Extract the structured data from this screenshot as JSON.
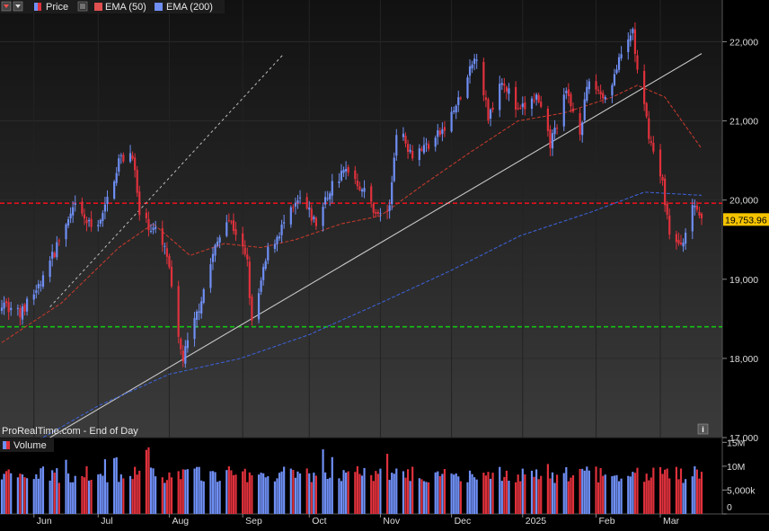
{
  "toolbar": {
    "price_label": "Price",
    "ema50_label": "EMA (50)",
    "ema200_label": "EMA (200)",
    "volume_label": "Volume"
  },
  "footer": {
    "source_text": "ProRealTime.com - End of Day",
    "info_glyph": "i"
  },
  "colors": {
    "up": "#6f8ff5",
    "down": "#e0313c",
    "ema50": "#c0392b",
    "ema200": "#3b5fd0",
    "resistance": "#e3121a",
    "support": "#13c213",
    "trendline": "#c8c8c8",
    "last_price_bg": "#f5c400"
  },
  "chart_data": {
    "type": "candlestick",
    "last_price_label": "19,753.96",
    "price_axis": {
      "ylim": [
        17000,
        22300
      ],
      "ticks": [
        "22,000",
        "21,000",
        "20,000",
        "19,000",
        "18,000",
        "17,000"
      ],
      "tick_values": [
        22000,
        21000,
        20000,
        19000,
        18000,
        17000
      ]
    },
    "volume_axis": {
      "ylim": [
        0,
        16000000
      ],
      "ticks": [
        "15M",
        "10M",
        "5,000k",
        "0"
      ],
      "tick_values": [
        15000000,
        10000000,
        5000000,
        0
      ]
    },
    "x_labels": [
      "Jun",
      "Jul",
      "Aug",
      "Sep",
      "Oct",
      "Nov",
      "Dec",
      "2025",
      "Feb",
      "Mar"
    ],
    "x_label_dates": [
      "2024-06-03",
      "2024-07-01",
      "2024-08-01",
      "2024-09-02",
      "2024-10-01",
      "2024-11-01",
      "2024-12-02",
      "2025-01-02",
      "2025-02-03",
      "2025-03-03"
    ],
    "horizontal_levels": {
      "resistance": 19960,
      "support": 18400
    },
    "trendline": {
      "from": [
        "2024-06-10",
        17000
      ],
      "to": [
        "2025-03-21",
        21850
      ]
    },
    "channel_line": {
      "from": [
        "2024-06-10",
        18650
      ],
      "to": [
        "2024-09-20",
        21850
      ]
    },
    "anchors": [
      [
        "2024-05-20",
        18720
      ],
      [
        "2024-05-28",
        18550
      ],
      [
        "2024-06-07",
        19000
      ],
      [
        "2024-06-14",
        19500
      ],
      [
        "2024-06-21",
        19900
      ],
      [
        "2024-06-28",
        19650
      ],
      [
        "2024-07-03",
        19800
      ],
      [
        "2024-07-10",
        20500
      ],
      [
        "2024-07-16",
        20600
      ],
      [
        "2024-07-19",
        19800
      ],
      [
        "2024-07-26",
        19600
      ],
      [
        "2024-07-31",
        19300
      ],
      [
        "2024-08-05",
        18200
      ],
      [
        "2024-08-07",
        18000
      ],
      [
        "2024-08-12",
        18450
      ],
      [
        "2024-08-20",
        19300
      ],
      [
        "2024-08-26",
        19800
      ],
      [
        "2024-08-30",
        19600
      ],
      [
        "2024-09-04",
        19200
      ],
      [
        "2024-09-06",
        18420
      ],
      [
        "2024-09-13",
        19350
      ],
      [
        "2024-09-20",
        19700
      ],
      [
        "2024-09-27",
        20000
      ],
      [
        "2024-10-04",
        19700
      ],
      [
        "2024-10-11",
        20200
      ],
      [
        "2024-10-18",
        20400
      ],
      [
        "2024-10-25",
        20100
      ],
      [
        "2024-10-31",
        19800
      ],
      [
        "2024-11-05",
        19900
      ],
      [
        "2024-11-08",
        20900
      ],
      [
        "2024-11-15",
        20600
      ],
      [
        "2024-11-22",
        20700
      ],
      [
        "2024-11-29",
        20900
      ],
      [
        "2024-12-06",
        21300
      ],
      [
        "2024-12-13",
        21850
      ],
      [
        "2024-12-18",
        21050
      ],
      [
        "2024-12-24",
        21550
      ],
      [
        "2024-12-31",
        21100
      ],
      [
        "2025-01-08",
        21300
      ],
      [
        "2025-01-14",
        20700
      ],
      [
        "2025-01-21",
        21350
      ],
      [
        "2025-01-27",
        20900
      ],
      [
        "2025-01-31",
        21500
      ],
      [
        "2025-02-07",
        21300
      ],
      [
        "2025-02-14",
        21800
      ],
      [
        "2025-02-19",
        22150
      ],
      [
        "2025-02-21",
        21600
      ],
      [
        "2025-02-27",
        20700
      ],
      [
        "2025-03-04",
        20200
      ],
      [
        "2025-03-07",
        19600
      ],
      [
        "2025-03-11",
        19400
      ],
      [
        "2025-03-14",
        19600
      ],
      [
        "2025-03-18",
        19950
      ],
      [
        "2025-03-21",
        19753.96
      ]
    ],
    "ema50_anchors": [
      [
        "2024-05-20",
        18200
      ],
      [
        "2024-06-15",
        18700
      ],
      [
        "2024-07-10",
        19400
      ],
      [
        "2024-07-25",
        19700
      ],
      [
        "2024-08-10",
        19300
      ],
      [
        "2024-08-25",
        19450
      ],
      [
        "2024-09-10",
        19400
      ],
      [
        "2024-09-25",
        19500
      ],
      [
        "2024-10-15",
        19700
      ],
      [
        "2024-11-01",
        19800
      ],
      [
        "2024-11-20",
        20200
      ],
      [
        "2024-12-10",
        20600
      ],
      [
        "2024-12-31",
        21000
      ],
      [
        "2025-01-20",
        21100
      ],
      [
        "2025-02-10",
        21300
      ],
      [
        "2025-02-21",
        21450
      ],
      [
        "2025-03-05",
        21300
      ],
      [
        "2025-03-21",
        20650
      ]
    ],
    "ema200_anchors": [
      [
        "2024-06-01",
        16900
      ],
      [
        "2024-07-01",
        17400
      ],
      [
        "2024-08-01",
        17800
      ],
      [
        "2024-09-01",
        18000
      ],
      [
        "2024-10-01",
        18300
      ],
      [
        "2024-11-01",
        18700
      ],
      [
        "2024-12-01",
        19100
      ],
      [
        "2025-01-01",
        19550
      ],
      [
        "2025-02-01",
        19850
      ],
      [
        "2025-02-24",
        20100
      ],
      [
        "2025-03-21",
        20060
      ]
    ]
  }
}
